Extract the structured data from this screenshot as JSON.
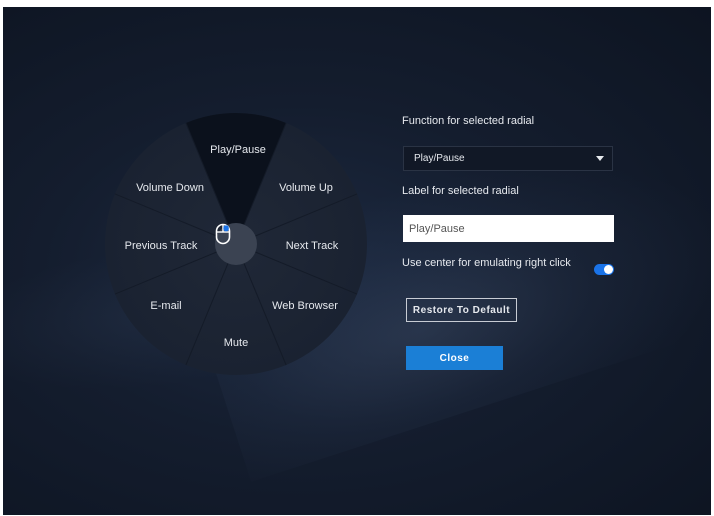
{
  "radial": {
    "slices": [
      {
        "id": "play-pause",
        "label": "Play/Pause",
        "selected": true
      },
      {
        "id": "volume-up",
        "label": "Volume Up"
      },
      {
        "id": "next-track",
        "label": "Next Track"
      },
      {
        "id": "web-browser",
        "label": "Web Browser"
      },
      {
        "id": "mute",
        "label": "Mute"
      },
      {
        "id": "email",
        "label": "E-mail"
      },
      {
        "id": "previous-track",
        "label": "Previous Track"
      },
      {
        "id": "volume-down",
        "label": "Volume Down"
      }
    ],
    "center_icon": "mouse-icon"
  },
  "panel": {
    "function_label": "Function for selected radial",
    "function_value": "Play/Pause",
    "label_label": "Label for selected radial",
    "label_value": "Play/Pause",
    "right_click_label": "Use center for emulating right click",
    "right_click_enabled": true,
    "restore_label": "Restore To Default",
    "close_label": "Close"
  },
  "colors": {
    "accent": "#1b7fd6",
    "toggle_on": "#1a73e8",
    "background": "#141d2e",
    "selected_slice": "#0b111c"
  }
}
